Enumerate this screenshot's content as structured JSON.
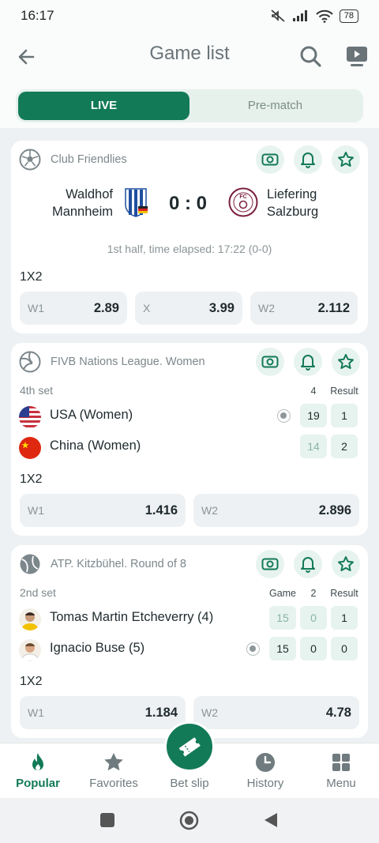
{
  "status_bar": {
    "time": "16:17",
    "battery": "78"
  },
  "header": {
    "title": "Game list"
  },
  "tabs": [
    {
      "label": "LIVE",
      "active": true
    },
    {
      "label": "Pre-match",
      "active": false
    }
  ],
  "colors": {
    "accent": "#137a58",
    "accent_light": "#e7f3ee",
    "background": "#eef1f3"
  },
  "cards": [
    {
      "sport_icon": "football-icon",
      "league": "Club Friendlies",
      "team1": {
        "name_line1": "Waldhof",
        "name_line2": "Mannheim"
      },
      "team2": {
        "name_line1": "Liefering",
        "name_line2": "Salzburg"
      },
      "score": "0 : 0",
      "info": "1st half, time elapsed: 17:22 (0-0)",
      "market": "1X2",
      "odds": [
        {
          "label": "W1",
          "value": "2.89"
        },
        {
          "label": "X",
          "value": "3.99"
        },
        {
          "label": "W2",
          "value": "2.112"
        }
      ]
    },
    {
      "sport_icon": "volleyball-icon",
      "league": "FIVB Nations League. Women",
      "period": "4th set",
      "columns": [
        "4",
        "Result"
      ],
      "players": [
        {
          "name": "USA (Women)",
          "scores": [
            "19",
            "1"
          ],
          "serving": true
        },
        {
          "name": "China (Women)",
          "scores": [
            "14",
            "2"
          ],
          "serving": false
        }
      ],
      "market": "1X2",
      "odds": [
        {
          "label": "W1",
          "value": "1.416"
        },
        {
          "label": "W2",
          "value": "2.896"
        }
      ]
    },
    {
      "sport_icon": "tennis-icon",
      "league": "ATP. Kitzbühel. Round of 8",
      "period": "2nd set",
      "columns": [
        "Game",
        "2",
        "Result"
      ],
      "players": [
        {
          "name": "Tomas Martin Etcheverry (4)",
          "scores": [
            "15",
            "0",
            "1"
          ],
          "serving": false
        },
        {
          "name": "Ignacio Buse (5)",
          "scores": [
            "15",
            "0",
            "0"
          ],
          "serving": true
        }
      ],
      "market": "1X2",
      "odds": [
        {
          "label": "W1",
          "value": "1.184"
        },
        {
          "label": "W2",
          "value": "4.78"
        }
      ]
    }
  ],
  "bottom_nav": [
    {
      "label": "Popular",
      "icon": "fire-icon",
      "active": true
    },
    {
      "label": "Favorites",
      "icon": "star-icon",
      "active": false
    },
    {
      "label": "Bet slip",
      "icon": "ticket-icon",
      "active": false
    },
    {
      "label": "History",
      "icon": "clock-icon",
      "active": false
    },
    {
      "label": "Menu",
      "icon": "grid-icon",
      "active": false
    }
  ]
}
